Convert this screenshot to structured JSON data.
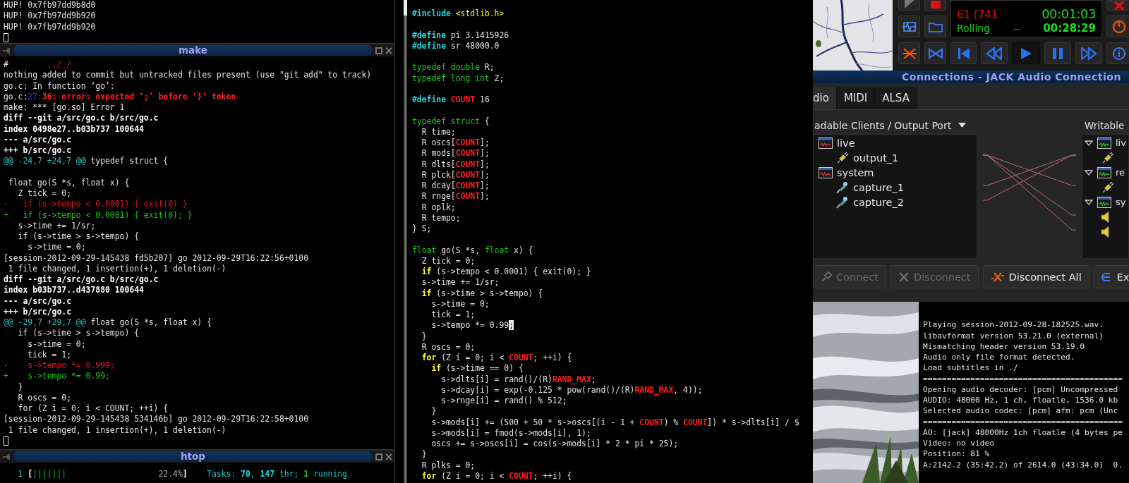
{
  "left_column": {
    "top_terminal": {
      "lines": [
        {
          "kind": "plain",
          "text": "HUP! 0x7fb97dd9b8d0"
        },
        {
          "kind": "plain",
          "text": "HUP! 0x7fb97dd9b920"
        },
        {
          "kind": "plain",
          "text": "HUP! 0x7fb97dd9b920"
        }
      ],
      "cursor": true
    },
    "make_window": {
      "title": "make",
      "lines": [
        {
          "parts": [
            {
              "kind": "plain",
              "text": "#        "
            },
            {
              "kind": "removed",
              "text": "../_/"
            }
          ]
        },
        {
          "kind": "plain",
          "text": "nothing added to commit but untracked files present (use \"git add\" to track)"
        },
        {
          "kind": "plain",
          "text": "go.c: In function ‘go’:"
        },
        {
          "parts": [
            {
              "kind": "plain",
              "text": "go.c:"
            },
            {
              "kind": "linenum",
              "text": "27:"
            },
            {
              "kind": "error",
              "text": "36: error: expected ‘;’ before ‘}’ token"
            }
          ]
        },
        {
          "kind": "plain",
          "text": "make: *** [go.so] Error 1"
        },
        {
          "kind": "bold",
          "text": "diff --git a/src/go.c b/src/go.c"
        },
        {
          "kind": "bold",
          "text": "index 0498e27..b03b737 100644"
        },
        {
          "kind": "bold",
          "text": "--- a/src/go.c"
        },
        {
          "kind": "bold",
          "text": "+++ b/src/go.c"
        },
        {
          "parts": [
            {
              "kind": "hunk",
              "text": "@@ -24,7 +24,7 @@"
            },
            {
              "kind": "plain",
              "text": " typedef struct {"
            }
          ]
        },
        {
          "kind": "blank"
        },
        {
          "kind": "plain",
          "text": " float go(S *s, float x) {"
        },
        {
          "kind": "plain",
          "text": "   Z tick = 0;"
        },
        {
          "kind": "removed",
          "text": "-   if (s->tempo < 0.0001) { exit(0) }"
        },
        {
          "kind": "added",
          "text": "+   if (s->tempo < 0.0001) { exit(0); }"
        },
        {
          "kind": "plain",
          "text": "   s->time += 1/sr;"
        },
        {
          "kind": "plain",
          "text": "   if (s->time > s->tempo) {"
        },
        {
          "kind": "plain",
          "text": "     s->time = 0;"
        },
        {
          "kind": "plain",
          "text": "[session-2012-09-29-145438 fd5b207] go 2012-09-29T16:22:56+0100"
        },
        {
          "kind": "plain",
          "text": " 1 file changed, 1 insertion(+), 1 deletion(-)"
        },
        {
          "kind": "bold",
          "text": "diff --git a/src/go.c b/src/go.c"
        },
        {
          "kind": "bold",
          "text": "index b03b737..d437880 100644"
        },
        {
          "kind": "bold",
          "text": "--- a/src/go.c"
        },
        {
          "kind": "bold",
          "text": "+++ b/src/go.c"
        },
        {
          "parts": [
            {
              "kind": "hunk",
              "text": "@@ -29,7 +29,7 @@"
            },
            {
              "kind": "plain",
              "text": " float go(S *s, float x) {"
            }
          ]
        },
        {
          "kind": "plain",
          "text": "   if (s->time > s->tempo) {"
        },
        {
          "kind": "plain",
          "text": "     s->time = 0;"
        },
        {
          "kind": "plain",
          "text": "     tick = 1;"
        },
        {
          "kind": "removed",
          "text": "-    s->tempo *= 0.999;"
        },
        {
          "kind": "added",
          "text": "+    s->tempo *= 0.99;"
        },
        {
          "kind": "plain",
          "text": "   }"
        },
        {
          "kind": "plain",
          "text": "   R oscs = 0;"
        },
        {
          "kind": "plain",
          "text": "   for (Z i = 0; i < COUNT; ++i) {"
        },
        {
          "kind": "plain",
          "text": "[session-2012-09-29-145438 534146b] go 2012-09-29T16:22:58+0100"
        },
        {
          "kind": "plain",
          "text": " 1 file changed, 1 insertion(+), 1 deletion(-)"
        }
      ],
      "cursor": true
    },
    "htop_window": {
      "title": "htop",
      "lines": [
        {
          "parts": [
            {
              "kind": "htopnum",
              "text": "   1 "
            },
            {
              "kind": "bold",
              "text": "["
            },
            {
              "kind": "meter",
              "text": "|||||||"
            },
            {
              "kind": "dim",
              "text": "                   22.4%"
            },
            {
              "kind": "bold",
              "text": "]"
            },
            {
              "kind": "htopnum",
              "text": "    Tasks: "
            },
            {
              "kind": "htopbold",
              "text": "70"
            },
            {
              "kind": "htopnum",
              "text": ", "
            },
            {
              "kind": "htopbold",
              "text": "147"
            },
            {
              "kind": "htopnum",
              "text": " thr; "
            },
            {
              "kind": "ok",
              "text": "1"
            },
            {
              "kind": "htopnum",
              "text": " running"
            }
          ]
        }
      ]
    }
  },
  "editor": {
    "lines": [
      {
        "parts": [
          {
            "kind": "preproc",
            "text": "#include"
          },
          {
            "kind": "string",
            "text": " <stdlib.h>"
          }
        ]
      },
      {
        "kind": "blank"
      },
      {
        "parts": [
          {
            "kind": "preproc",
            "text": "#define"
          },
          {
            "kind": "plain",
            "text": " pi 3.1415926"
          }
        ]
      },
      {
        "parts": [
          {
            "kind": "preproc",
            "text": "#define"
          },
          {
            "kind": "plain",
            "text": " sr 48000.0"
          }
        ]
      },
      {
        "kind": "blank"
      },
      {
        "parts": [
          {
            "kind": "type",
            "text": "typedef double"
          },
          {
            "kind": "plain",
            "text": " R;"
          }
        ]
      },
      {
        "parts": [
          {
            "kind": "type",
            "text": "typedef long int"
          },
          {
            "kind": "plain",
            "text": " Z;"
          }
        ]
      },
      {
        "kind": "blank"
      },
      {
        "parts": [
          {
            "kind": "preproc",
            "text": "#define"
          },
          {
            "kind": "constant",
            "text": " COUNT"
          },
          {
            "kind": "plain",
            "text": " 16"
          }
        ]
      },
      {
        "kind": "blank"
      },
      {
        "parts": [
          {
            "kind": "type",
            "text": "typedef struct"
          },
          {
            "kind": "plain",
            "text": " {"
          }
        ]
      },
      {
        "kind": "plain",
        "text": "  R time;"
      },
      {
        "parts": [
          {
            "kind": "plain",
            "text": "  R oscs["
          },
          {
            "kind": "constant",
            "text": "COUNT"
          },
          {
            "kind": "plain",
            "text": "];"
          }
        ]
      },
      {
        "parts": [
          {
            "kind": "plain",
            "text": "  R mods["
          },
          {
            "kind": "constant",
            "text": "COUNT"
          },
          {
            "kind": "plain",
            "text": "];"
          }
        ]
      },
      {
        "parts": [
          {
            "kind": "plain",
            "text": "  R dlts["
          },
          {
            "kind": "constant",
            "text": "COUNT"
          },
          {
            "kind": "plain",
            "text": "];"
          }
        ]
      },
      {
        "parts": [
          {
            "kind": "plain",
            "text": "  R plck["
          },
          {
            "kind": "constant",
            "text": "COUNT"
          },
          {
            "kind": "plain",
            "text": "];"
          }
        ]
      },
      {
        "parts": [
          {
            "kind": "plain",
            "text": "  R dcay["
          },
          {
            "kind": "constant",
            "text": "COUNT"
          },
          {
            "kind": "plain",
            "text": "];"
          }
        ]
      },
      {
        "parts": [
          {
            "kind": "plain",
            "text": "  R rnge["
          },
          {
            "kind": "constant",
            "text": "COUNT"
          },
          {
            "kind": "plain",
            "text": "];"
          }
        ]
      },
      {
        "kind": "plain",
        "text": "  R oplk;"
      },
      {
        "kind": "plain",
        "text": "  R tempo;"
      },
      {
        "kind": "plain",
        "text": "} S;"
      },
      {
        "kind": "blank"
      },
      {
        "parts": [
          {
            "kind": "type",
            "text": "float"
          },
          {
            "kind": "plain",
            "text": " go(S *s, "
          },
          {
            "kind": "type",
            "text": "float"
          },
          {
            "kind": "plain",
            "text": " x) {"
          }
        ]
      },
      {
        "kind": "plain",
        "text": "  Z tick = 0;"
      },
      {
        "parts": [
          {
            "kind": "keyword",
            "text": "  if"
          },
          {
            "kind": "plain",
            "text": " (s->tempo < 0.0001) { exit(0); }"
          }
        ]
      },
      {
        "kind": "plain",
        "text": "  s->time += 1/sr;"
      },
      {
        "parts": [
          {
            "kind": "keyword",
            "text": "  if"
          },
          {
            "kind": "plain",
            "text": " (s->time > s->tempo) {"
          }
        ]
      },
      {
        "kind": "plain",
        "text": "    s->time = 0;"
      },
      {
        "kind": "plain",
        "text": "    tick = 1;"
      },
      {
        "parts": [
          {
            "kind": "plain",
            "text": "    s->tempo *= 0.99"
          },
          {
            "kind": "cursor",
            "text": ";"
          }
        ]
      },
      {
        "kind": "plain",
        "text": "  }"
      },
      {
        "kind": "plain",
        "text": "  R oscs = 0;"
      },
      {
        "parts": [
          {
            "kind": "keyword",
            "text": "  for"
          },
          {
            "kind": "plain",
            "text": " (Z i = 0; i < "
          },
          {
            "kind": "constant",
            "text": "COUNT"
          },
          {
            "kind": "plain",
            "text": "; ++i) {"
          }
        ]
      },
      {
        "parts": [
          {
            "kind": "keyword",
            "text": "    if"
          },
          {
            "kind": "plain",
            "text": " (s->time == 0) {"
          }
        ]
      },
      {
        "parts": [
          {
            "kind": "plain",
            "text": "      s->dlts[i] = rand()/(R)"
          },
          {
            "kind": "constant",
            "text": "RAND_MAX"
          },
          {
            "kind": "plain",
            "text": ";"
          }
        ]
      },
      {
        "parts": [
          {
            "kind": "plain",
            "text": "      s->dcay[i] = exp(-0.125 * pow(rand()/(R)"
          },
          {
            "kind": "constant",
            "text": "RAND_MAX"
          },
          {
            "kind": "plain",
            "text": ", 4));"
          }
        ]
      },
      {
        "kind": "plain",
        "text": "      s->rnge[i] = rand() % 512;"
      },
      {
        "kind": "plain",
        "text": "    }"
      },
      {
        "parts": [
          {
            "kind": "plain",
            "text": "    s->mods[i] += (500 + 50 * s->oscs[(i - 1 + "
          },
          {
            "kind": "constant",
            "text": "COUNT"
          },
          {
            "kind": "plain",
            "text": ") % "
          },
          {
            "kind": "constant",
            "text": "COUNT"
          },
          {
            "kind": "plain",
            "text": "]) * s->dlts[i] / $"
          }
        ]
      },
      {
        "kind": "plain",
        "text": "    s->mods[i] = fmod(s->mods[i], 1);"
      },
      {
        "kind": "plain",
        "text": "    oscs += s->oscs[i] = cos(s->mods[i] * 2 * pi * 25);"
      },
      {
        "kind": "plain",
        "text": "  }"
      },
      {
        "kind": "plain",
        "text": "  R plks = 0;"
      },
      {
        "parts": [
          {
            "kind": "keyword",
            "text": "  for"
          },
          {
            "kind": "plain",
            "text": " (Z i = 0; i < "
          },
          {
            "kind": "constant",
            "text": "COUNT"
          },
          {
            "kind": "plain",
            "text": "; ++i) {"
          }
        ]
      }
    ]
  },
  "qjackctl": {
    "buttons_row_1": [
      {
        "kind": "triangle"
      },
      {
        "kind": "square"
      }
    ],
    "buttons_row_2": [
      {
        "kind": "graph"
      },
      {
        "kind": "folder"
      }
    ],
    "display": {
      "row_1": [
        "61 (741",
        "00:01:03"
      ],
      "row_2": [
        "Rolling",
        "--",
        "00:28:29"
      ]
    },
    "side_buttons": [
      {
        "kind": "close"
      },
      {
        "kind": "power"
      },
      {
        "kind": "info"
      }
    ],
    "transport": [
      {
        "kind": "cross",
        "selected": false
      },
      {
        "kind": "bowtie",
        "selected": false
      },
      {
        "kind": "skip-back",
        "selected": false
      },
      {
        "kind": "rewind",
        "selected": false
      },
      {
        "kind": "play",
        "selected": true
      },
      {
        "kind": "pause",
        "selected": false
      },
      {
        "kind": "forward",
        "selected": false
      }
    ]
  },
  "connections_window": {
    "title": "Connections - JACK Audio Connection",
    "tabs": [
      {
        "label": "dio",
        "selected": true
      },
      {
        "label": "MIDI",
        "selected": false
      },
      {
        "label": "ALSA",
        "selected": false
      }
    ],
    "readable_header": "adable Clients / Output Port",
    "readable_clients": [
      {
        "name": "live",
        "kind": "client",
        "children": [
          {
            "name": "output_1",
            "kind": "output"
          }
        ]
      },
      {
        "name": "system",
        "kind": "client",
        "children": [
          {
            "name": "capture_1",
            "kind": "capture"
          },
          {
            "name": "capture_2",
            "kind": "capture"
          }
        ]
      }
    ],
    "writable_header": "Writable",
    "writable_clients": [
      {
        "name": "liv",
        "kind": "client",
        "expanded": true,
        "children": [
          {
            "kind": "output"
          }
        ]
      },
      {
        "name": "re",
        "kind": "client",
        "expanded": true,
        "children": [
          {
            "kind": "output"
          }
        ]
      },
      {
        "name": "sy",
        "kind": "client",
        "expanded": true,
        "children": [
          {
            "kind": "speaker"
          },
          {
            "kind": "speaker"
          }
        ]
      }
    ],
    "buttons": [
      {
        "label": "Connect",
        "kind": "connect",
        "disabled": true
      },
      {
        "label": "Disconnect",
        "kind": "disconnect",
        "disabled": true
      },
      {
        "label": "Disconnect All",
        "kind": "disconnect-all",
        "disabled": false
      },
      {
        "label": "Ex",
        "kind": "expand",
        "disabled": false
      }
    ]
  },
  "mplayer_terminal": {
    "lines": [
      {
        "kind": "blank"
      },
      {
        "kind": "plain",
        "text": "Playing session-2012-09-28-182525.wav."
      },
      {
        "kind": "plain",
        "text": "libavformat version 53.21.0 (external)"
      },
      {
        "kind": "plain",
        "text": "Mismatching header version 53.19.0"
      },
      {
        "kind": "plain",
        "text": "Audio only file format detected."
      },
      {
        "kind": "plain",
        "text": "Load subtitles in ./"
      },
      {
        "kind": "plain",
        "text": "=========================================="
      },
      {
        "kind": "plain",
        "text": "Opening audio decoder: [pcm] Uncompressed"
      },
      {
        "kind": "plain",
        "text": "AUDIO: 48000 Hz, 1 ch, floatle, 1536.0 kb"
      },
      {
        "kind": "plain",
        "text": "Selected audio codec: [pcm] afm: pcm (Unc"
      },
      {
        "kind": "plain",
        "text": "=========================================="
      },
      {
        "kind": "plain",
        "text": "AO: [jack] 48000Hz 1ch floatle (4 bytes pe"
      },
      {
        "kind": "plain",
        "text": "Video: no video"
      },
      {
        "kind": "plain",
        "text": "Position: 81 %"
      },
      {
        "kind": "plain",
        "text": "A:2142.2 (35:42.2) of 2614.0 (43:34.0)  0."
      }
    ]
  }
}
